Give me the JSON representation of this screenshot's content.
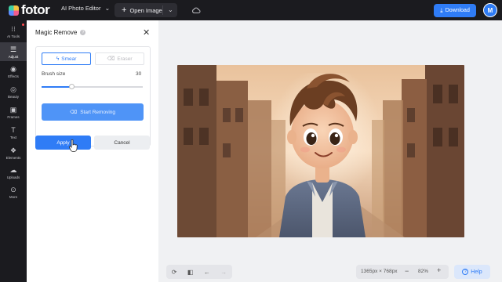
{
  "topbar": {
    "logo_text": "fotor",
    "ai_photo_editor_label": "AI Photo Editor",
    "open_image_label": "Open Image",
    "download_label": "Download",
    "avatar_initial": "M"
  },
  "rail": {
    "items": [
      {
        "label": "AI Tools",
        "icon": "grid-icon"
      },
      {
        "label": "Adjust",
        "icon": "sliders-icon"
      },
      {
        "label": "Effects",
        "icon": "effects-icon"
      },
      {
        "label": "Beauty",
        "icon": "eye-icon"
      },
      {
        "label": "Frames",
        "icon": "frame-icon"
      },
      {
        "label": "Text",
        "icon": "text-icon"
      },
      {
        "label": "Elements",
        "icon": "elements-icon"
      },
      {
        "label": "Uploads",
        "icon": "upload-icon"
      },
      {
        "label": "More",
        "icon": "more-icon"
      }
    ],
    "active_index": 1
  },
  "panel": {
    "title": "Magic Remove",
    "smear_label": "Smear",
    "eraser_label": "Eraser",
    "brush_size_label": "Brush size",
    "brush_size_value": "30",
    "brush_size_fraction": 0.3,
    "start_removing_label": "Start Removing",
    "apply_label": "Apply",
    "cancel_label": "Cancel"
  },
  "bottombar": {
    "image_size": "1365px × 768px",
    "zoom": "82%",
    "help_label": "Help"
  },
  "colors": {
    "accent": "#2f7cf6",
    "topbar_bg": "#1b1b1f",
    "canvas_bg": "#f0f1f3"
  }
}
